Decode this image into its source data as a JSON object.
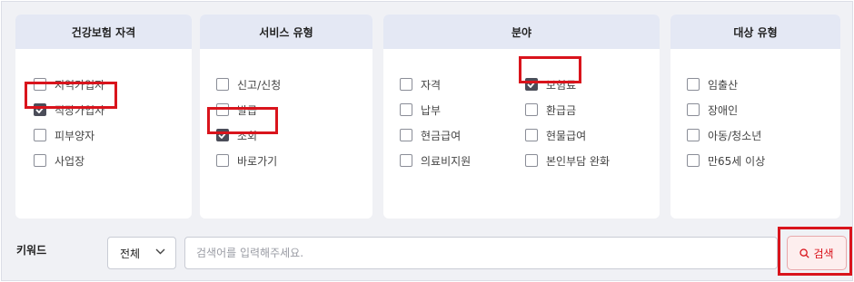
{
  "panels": [
    {
      "title": "건강보험 자격",
      "options": [
        {
          "label": "지역가입자",
          "checked": false
        },
        {
          "label": "직장가입자",
          "checked": true
        },
        {
          "label": "피부양자",
          "checked": false
        },
        {
          "label": "사업장",
          "checked": false
        }
      ]
    },
    {
      "title": "서비스 유형",
      "options": [
        {
          "label": "신고/신청",
          "checked": false
        },
        {
          "label": "발급",
          "checked": false
        },
        {
          "label": "조회",
          "checked": true
        },
        {
          "label": "바로가기",
          "checked": false
        }
      ]
    },
    {
      "title": "분야",
      "options": [
        {
          "label": "자격",
          "checked": false
        },
        {
          "label": "납부",
          "checked": false
        },
        {
          "label": "현금급여",
          "checked": false
        },
        {
          "label": "의료비지원",
          "checked": false
        },
        {
          "label": "보험료",
          "checked": true
        },
        {
          "label": "환급금",
          "checked": false
        },
        {
          "label": "현물급여",
          "checked": false
        },
        {
          "label": "본인부담 완화",
          "checked": false
        }
      ]
    },
    {
      "title": "대상 유형",
      "options": [
        {
          "label": "임출산",
          "checked": false
        },
        {
          "label": "장애인",
          "checked": false
        },
        {
          "label": "아동/청소년",
          "checked": false
        },
        {
          "label": "만65세 이상",
          "checked": false
        }
      ]
    }
  ],
  "keyword": {
    "label": "키워드",
    "scope_value": "전체",
    "placeholder": "검색어를 입력해주세요.",
    "value": ""
  },
  "search_button": {
    "label": "검색",
    "icon": "magnifier-icon"
  },
  "icons": {
    "chevron": "chevron-down-icon",
    "check": "check-icon"
  },
  "colors": {
    "highlight": "#d9141c",
    "panel_header": "#e4e8f4",
    "checkbox_checked": "#4b4d59",
    "background": "#f0f1f5"
  }
}
